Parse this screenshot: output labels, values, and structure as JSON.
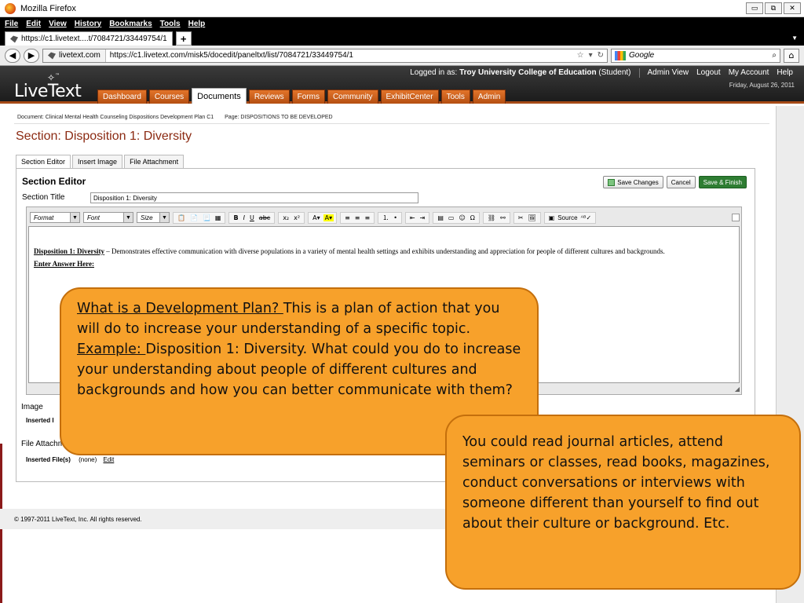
{
  "browser": {
    "window_title": "Mozilla Firefox",
    "menu": [
      "File",
      "Edit",
      "View",
      "History",
      "Bookmarks",
      "Tools",
      "Help"
    ],
    "tab_title": "https://c1.livetext....t/7084721/33449754/1",
    "new_tab": "+",
    "site_identity": "livetext.com",
    "url": "https://c1.livetext.com/misk5/docedit/paneltxt/list/7084721/33449754/1",
    "search_placeholder": "Google"
  },
  "header": {
    "logo": "LiveText",
    "logo_tm": "™",
    "logged_in_prefix": "Logged in as:",
    "logged_in_org": "Troy University College of Education",
    "logged_in_role": "(Student)",
    "links": [
      "Admin View",
      "Logout",
      "My Account",
      "Help"
    ],
    "date": "Friday, August 26, 2011",
    "nav": [
      "Dashboard",
      "Courses",
      "Documents",
      "Reviews",
      "Forms",
      "Community",
      "ExhibitCenter",
      "Tools",
      "Admin"
    ],
    "active_nav": "Documents"
  },
  "breadcrumb": {
    "document": "Document: Clinical Mental Health Counseling Dispositions Development Plan C1",
    "page": "Page: DISPOSITIONS TO BE DEVELOPED"
  },
  "section_title": "Section: Disposition 1: Diversity",
  "subtabs": [
    "Section Editor",
    "Insert Image",
    "File Attachment"
  ],
  "editor": {
    "heading": "Section Editor",
    "buttons": {
      "save": "Save Changes",
      "cancel": "Cancel",
      "finish": "Save & Finish"
    },
    "title_label": "Section Title",
    "title_value": "Disposition 1: Diversity",
    "toolbar": {
      "format": "Format",
      "font": "Font",
      "size": "Size",
      "source": "Source"
    },
    "content": {
      "disposition_label": "Disposition 1:  Diversity",
      "disposition_text": " – Demonstrates effective communication with diverse populations in a variety of mental health settings and exhibits understanding and appreciation for people of different cultures and backgrounds.",
      "enter_answer": "Enter Answer Here:"
    },
    "image_label": "Image",
    "inserted_images": "Inserted I",
    "file_label": "File Attachm",
    "inserted_files_label": "Inserted File(s)",
    "inserted_files_value": "(none)",
    "edit_link": "Edit"
  },
  "footer": "© 1997-2011 LiveText, Inc. All rights reserved.",
  "callouts": {
    "q_heading": "What is a Development Plan? ",
    "q_text": "This is a plan of action that you will do to increase your understanding of a specific topic.",
    "example_heading": "Example: ",
    "example_text": "Disposition 1: Diversity.  What could you do to increase your understanding about people of different cultures and backgrounds and how you can better communicate with them?",
    "answer": "You could read journal articles, attend seminars or classes, read books, magazines, conduct conversations or interviews with someone different than yourself to find out about their culture or background.  Etc."
  }
}
